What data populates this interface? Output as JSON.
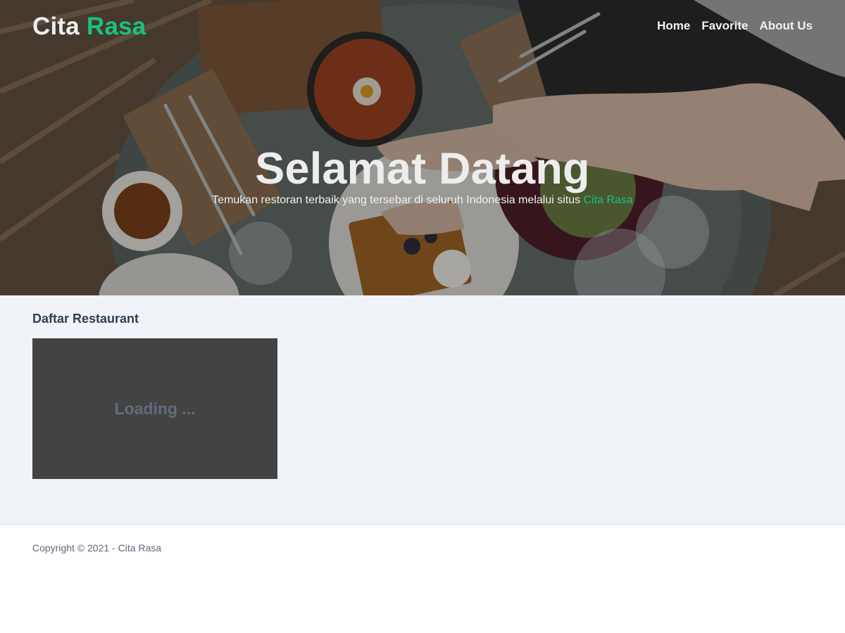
{
  "navbar": {
    "brand_part1": "Cita",
    "brand_part2": "Rasa",
    "links": [
      {
        "label": "Home"
      },
      {
        "label": "Favorite"
      },
      {
        "label": "About Us"
      }
    ]
  },
  "hero": {
    "title": "Selamat Datang",
    "subtitle_text": "Temukan restoran terbaik yang tersebar di seluruh Indonesia melalui situs",
    "subtitle_brand": "Cita Rasa"
  },
  "main": {
    "section_title": "Daftar Restaurant",
    "loading_text": "Loading ..."
  },
  "footer": {
    "copyright": "Copyright © 2021 - Cita Rasa"
  },
  "colors": {
    "accent": "#19c27f",
    "main_background": "#f0f3f8",
    "loading_card": "#434343",
    "heading_text": "#2f3f52"
  }
}
